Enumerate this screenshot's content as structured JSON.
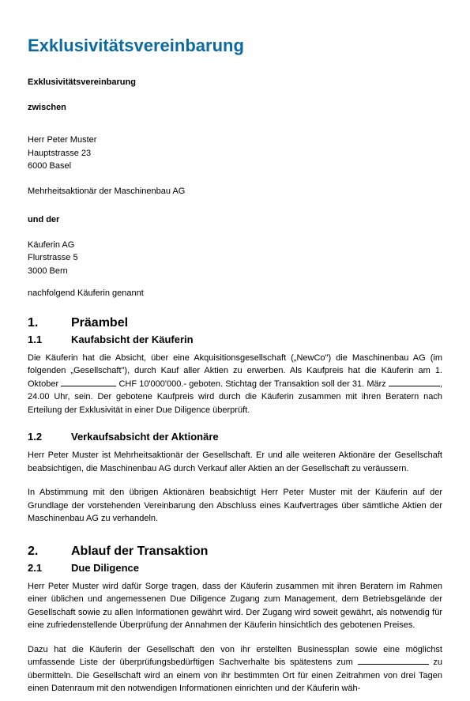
{
  "title": "Exklusivitätsvereinbarung",
  "subtitle": "Exklusivitätsvereinbarung",
  "between_label": "zwischen",
  "party1": {
    "name": "Herr Peter Muster",
    "street": "Hauptstrasse 23",
    "city": "6000 Basel",
    "role": "Mehrheitsaktionär der Maschinenbau AG"
  },
  "and_label": "und der",
  "party2": {
    "name": "Käuferin AG",
    "street": "Flurstrasse 5",
    "city": "3000 Bern",
    "role": "nachfolgend Käuferin genannt"
  },
  "s1": {
    "num": "1.",
    "title": "Präambel",
    "s11": {
      "num": "1.1",
      "title": "Kaufabsicht der Käuferin",
      "p1a": "Die Käuferin hat die Absicht, über eine Akquisitionsgesellschaft („NewCo\") die Maschinenbau AG (im folgenden „Gesellschaft\"), durch Kauf aller Aktien zu erwerben. Als Kaufpreis hat die Käuferin am 1. Oktober ",
      "p1b": " CHF 10'000'000.- geboten. Stichtag der Transaktion soll der 31. März ",
      "p1c": ", 24.00 Uhr, sein. Der gebotene Kaufpreis wird durch die Käuferin zusammen mit ihren Beratern nach Erteilung der Exklusivität in einer Due Diligence überprüft."
    },
    "s12": {
      "num": "1.2",
      "title": "Verkaufsabsicht der Aktionäre",
      "p1": "Herr Peter Muster ist Mehrheitsaktionär der Gesellschaft. Er und alle weiteren Aktionäre der Gesellschaft beabsichtigen, die Maschinenbau AG durch Verkauf aller Aktien an der Gesellschaft zu veräussern.",
      "p2": "In Abstimmung mit den übrigen Aktionären beabsichtigt Herr Peter Muster mit der Käuferin auf der Grundlage der vorstehenden Vereinbarung den Abschluss eines Kaufvertrages über sämtliche Aktien der Maschinenbau AG zu verhandeln."
    }
  },
  "s2": {
    "num": "2.",
    "title": "Ablauf der Transaktion",
    "s21": {
      "num": "2.1",
      "title": "Due Diligence",
      "p1": "Herr Peter Muster wird dafür Sorge tragen, dass der Käuferin zusammen mit ihren Beratern im Rahmen einer üblichen und angemessenen Due Diligence Zugang zum Management, dem Betriebsgelände der Gesellschaft sowie zu allen Informationen gewährt wird. Der Zugang wird soweit gewährt, als notwendig für eine zufriedenstellende Überprüfung der Annahmen der Käuferin hinsichtlich des gebotenen Preises.",
      "p2a": "Dazu hat die Käuferin der Gesellschaft den von ihr erstellten Businessplan sowie eine möglichst umfassende Liste der überprüfungsbedürftigen Sachverhalte bis spätestens zum ",
      "p2b": " zu übermitteln. Die Gesellschaft wird an einem von ihr bestimmten Ort für einen Zeitrahmen von drei Tagen einen Datenraum mit den notwendigen Informationen einrichten und der Käuferin wäh-"
    }
  }
}
